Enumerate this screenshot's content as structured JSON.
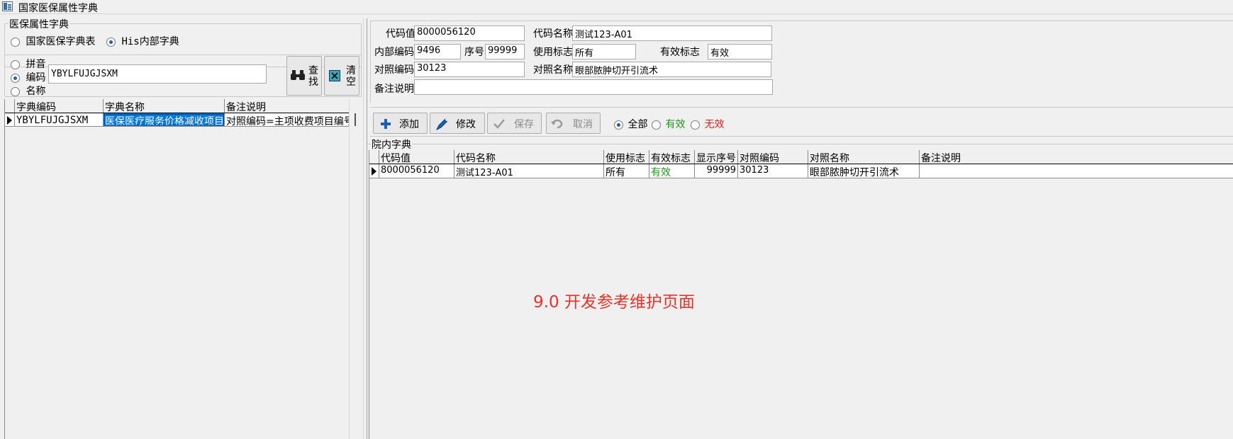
{
  "window": {
    "title": "国家医保属性字典"
  },
  "left": {
    "group_title": "医保属性字典",
    "source_radios": [
      {
        "label": "国家医保字典表",
        "checked": false
      },
      {
        "label": "His内部字典",
        "checked": true
      }
    ],
    "search_radios": [
      {
        "label": "拼音",
        "checked": false
      },
      {
        "label": "编码",
        "checked": true
      },
      {
        "label": "名称",
        "checked": false
      }
    ],
    "search_value": "YBYLFUJGJSXM",
    "find_button": "查找",
    "clear_button": "清空",
    "grid": {
      "columns": [
        "字典编码",
        "字典名称",
        "备注说明"
      ],
      "rows": [
        {
          "code": "YBYLFUJGJSXM",
          "name": "医保医疗服务价格减收项目",
          "remark": "对照编码=主项收费项目编号"
        }
      ]
    }
  },
  "detail": {
    "code_label": "代码值",
    "code_value": "8000056120",
    "name_label": "代码名称",
    "name_value": "测试123-A01",
    "internal_label": "内部编码",
    "internal_value": "9496",
    "seq_label": "序号",
    "seq_value": "99999",
    "use_label": "使用标志",
    "use_value": "所有",
    "valid_label": "有效标志",
    "valid_value": "有效",
    "map_code_label": "对照编码",
    "map_code_value": "30123",
    "map_name_label": "对照名称",
    "map_name_value": "眼部脓肿切开引流术",
    "remark_label": "备注说明",
    "remark_value": ""
  },
  "toolbar": {
    "add": "添加",
    "edit": "修改",
    "save": "保存",
    "cancel": "取消",
    "filter_all": "全部",
    "filter_valid": "有效",
    "filter_invalid": "无效"
  },
  "inner": {
    "group_title": "院内字典",
    "columns": [
      "代码值",
      "代码名称",
      "使用标志",
      "有效标志",
      "显示序号",
      "对照编码",
      "对照名称",
      "备注说明"
    ],
    "rows": [
      {
        "code": "8000056120",
        "name": "测试123-A01",
        "use": "所有",
        "valid": "有效",
        "seq": "99999",
        "map_code": "30123",
        "map_name": "眼部脓肿切开引流术",
        "remark": ""
      }
    ],
    "watermark": "9.0 开发参考维护页面"
  },
  "colors": {
    "valid_green": "#1a9a1a",
    "invalid_red": "#e02020",
    "selection_blue": "#0078d7",
    "watermark_red": "#e8322a"
  }
}
